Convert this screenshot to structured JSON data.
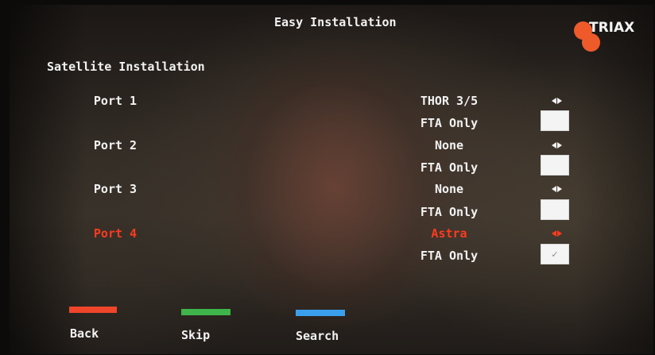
{
  "header": {
    "title": "Easy Installation"
  },
  "brand": {
    "logo_text": "TRIAX",
    "logo_color": "#ef5a2a"
  },
  "section": {
    "title": "Satellite Installation"
  },
  "ports": [
    {
      "label": "Port 1",
      "satellite": "THOR 3/5",
      "filter_label": "FTA Only",
      "fta_checked": false,
      "selected": false
    },
    {
      "label": "Port 2",
      "satellite": "None",
      "filter_label": "FTA Only",
      "fta_checked": false,
      "selected": false
    },
    {
      "label": "Port 3",
      "satellite": "None",
      "filter_label": "FTA Only",
      "fta_checked": false,
      "selected": false
    },
    {
      "label": "Port 4",
      "satellite": "Astra",
      "filter_label": "FTA Only",
      "fta_checked": true,
      "selected": true
    }
  ],
  "checkmark": "✓",
  "footer": {
    "buttons": [
      {
        "label": "Back",
        "color": "#f0452a"
      },
      {
        "label": "Skip",
        "color": "#3fb44a"
      },
      {
        "label": "Search",
        "color": "#3aa0ee"
      }
    ]
  },
  "colors": {
    "text": "#f2f2f2",
    "highlight": "#ff3b1f"
  }
}
